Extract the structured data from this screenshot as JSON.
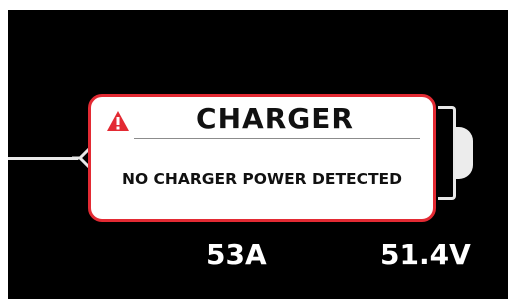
{
  "charger_panel": {
    "title": "CHARGER",
    "message": "NO CHARGER POWER DETECTED",
    "warning_icon": "warning-triangle-icon",
    "accent_color": "#e32a33"
  },
  "readouts": {
    "current": "53A",
    "voltage": "51.4V"
  }
}
